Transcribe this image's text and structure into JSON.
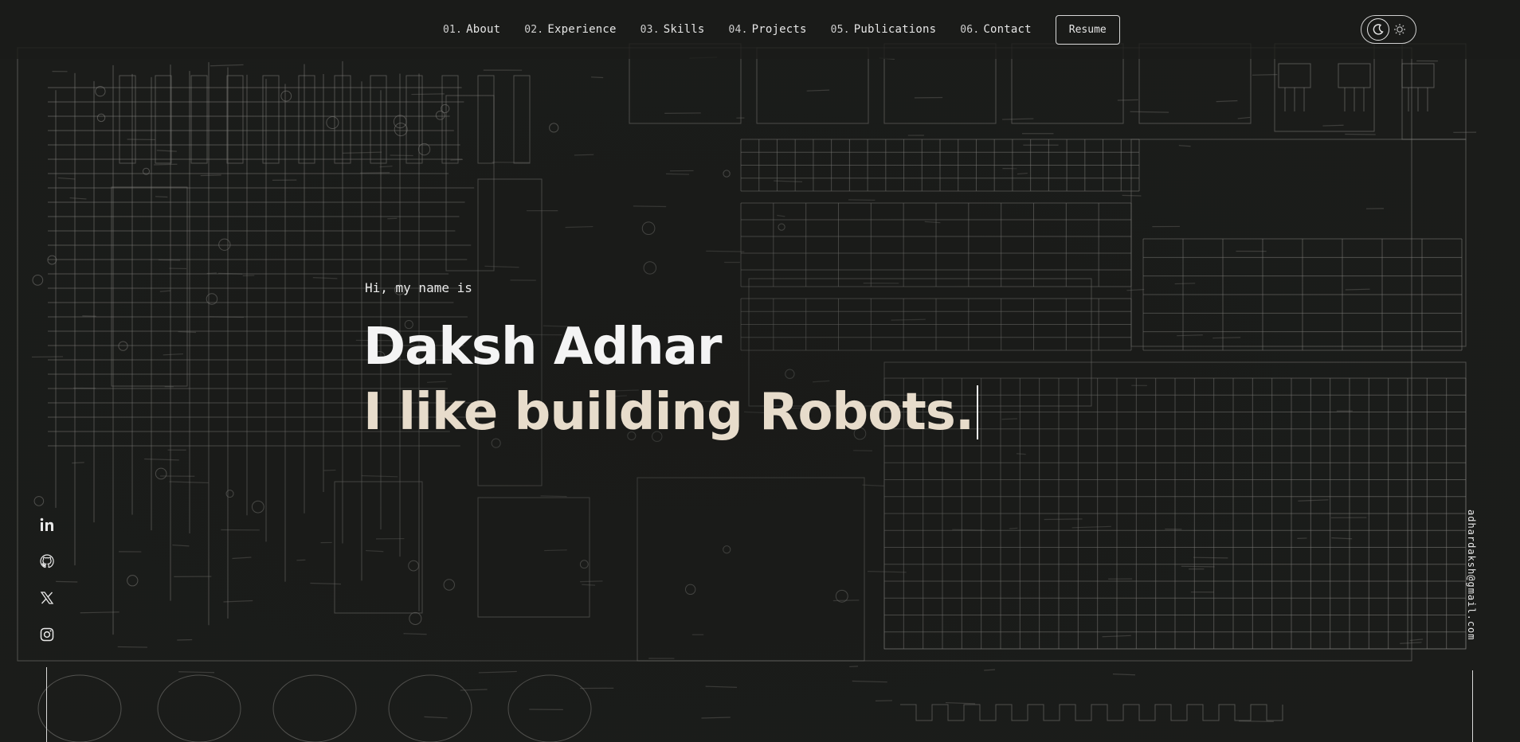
{
  "nav": {
    "items": [
      {
        "num": "01.",
        "label": "About"
      },
      {
        "num": "02.",
        "label": "Experience"
      },
      {
        "num": "03.",
        "label": "Skills"
      },
      {
        "num": "04.",
        "label": "Projects"
      },
      {
        "num": "05.",
        "label": "Publications"
      },
      {
        "num": "06.",
        "label": "Contact"
      }
    ],
    "resume_label": "Resume"
  },
  "theme_toggle": {
    "options": [
      "moon-icon",
      "sun-icon"
    ],
    "active": "dark"
  },
  "hero": {
    "intro": "Hi, my name is",
    "name": "Daksh Adhar",
    "tagline": "I like building Robots."
  },
  "socials": [
    "linkedin-icon",
    "github-icon",
    "x-icon",
    "instagram-icon"
  ],
  "email": "adhardaksh@gmail.com",
  "colors": {
    "background": "#1b1c1a",
    "text": "#f4f4f4",
    "accent": "#e7dccb",
    "schematic_lines": "#8a8a86"
  }
}
